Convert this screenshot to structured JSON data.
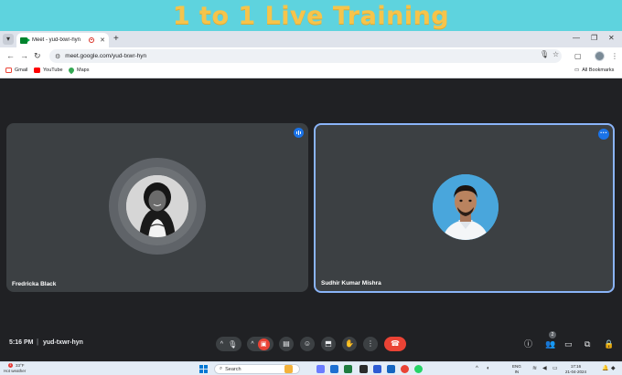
{
  "banner": {
    "title": "1 to 1 Live Training"
  },
  "browser": {
    "tab_title": "Meet - yud-txwr-hyn",
    "url": "meet.google.com/yud-txwr-hyn",
    "bookmarks": [
      "Gmail",
      "YouTube",
      "Maps"
    ],
    "all_bookmarks": "All Bookmarks"
  },
  "participants": [
    {
      "name": "Fredricka Black",
      "speaking": true
    },
    {
      "name": "Sudhir Kumar Mishra",
      "pinned": true
    }
  ],
  "meeting": {
    "time": "5:16 PM",
    "separator": "|",
    "code": "yud-txwr-hyn",
    "people_count": "2"
  },
  "taskbar": {
    "weather_temp": "33°F",
    "weather_desc": "Hot weather",
    "weather_badge": "1",
    "search_placeholder": "Search",
    "lang_line1": "ENG",
    "lang_line2": "IN",
    "clock_time": "17:16",
    "clock_date": "21-04-2024"
  },
  "colors": {
    "banner_bg": "#5ed3de",
    "banner_text": "#f6c44b",
    "meet_bg": "#202124",
    "tile_bg": "#3c4043",
    "accent_blue": "#1a73e8",
    "end_call_red": "#ea4335"
  }
}
